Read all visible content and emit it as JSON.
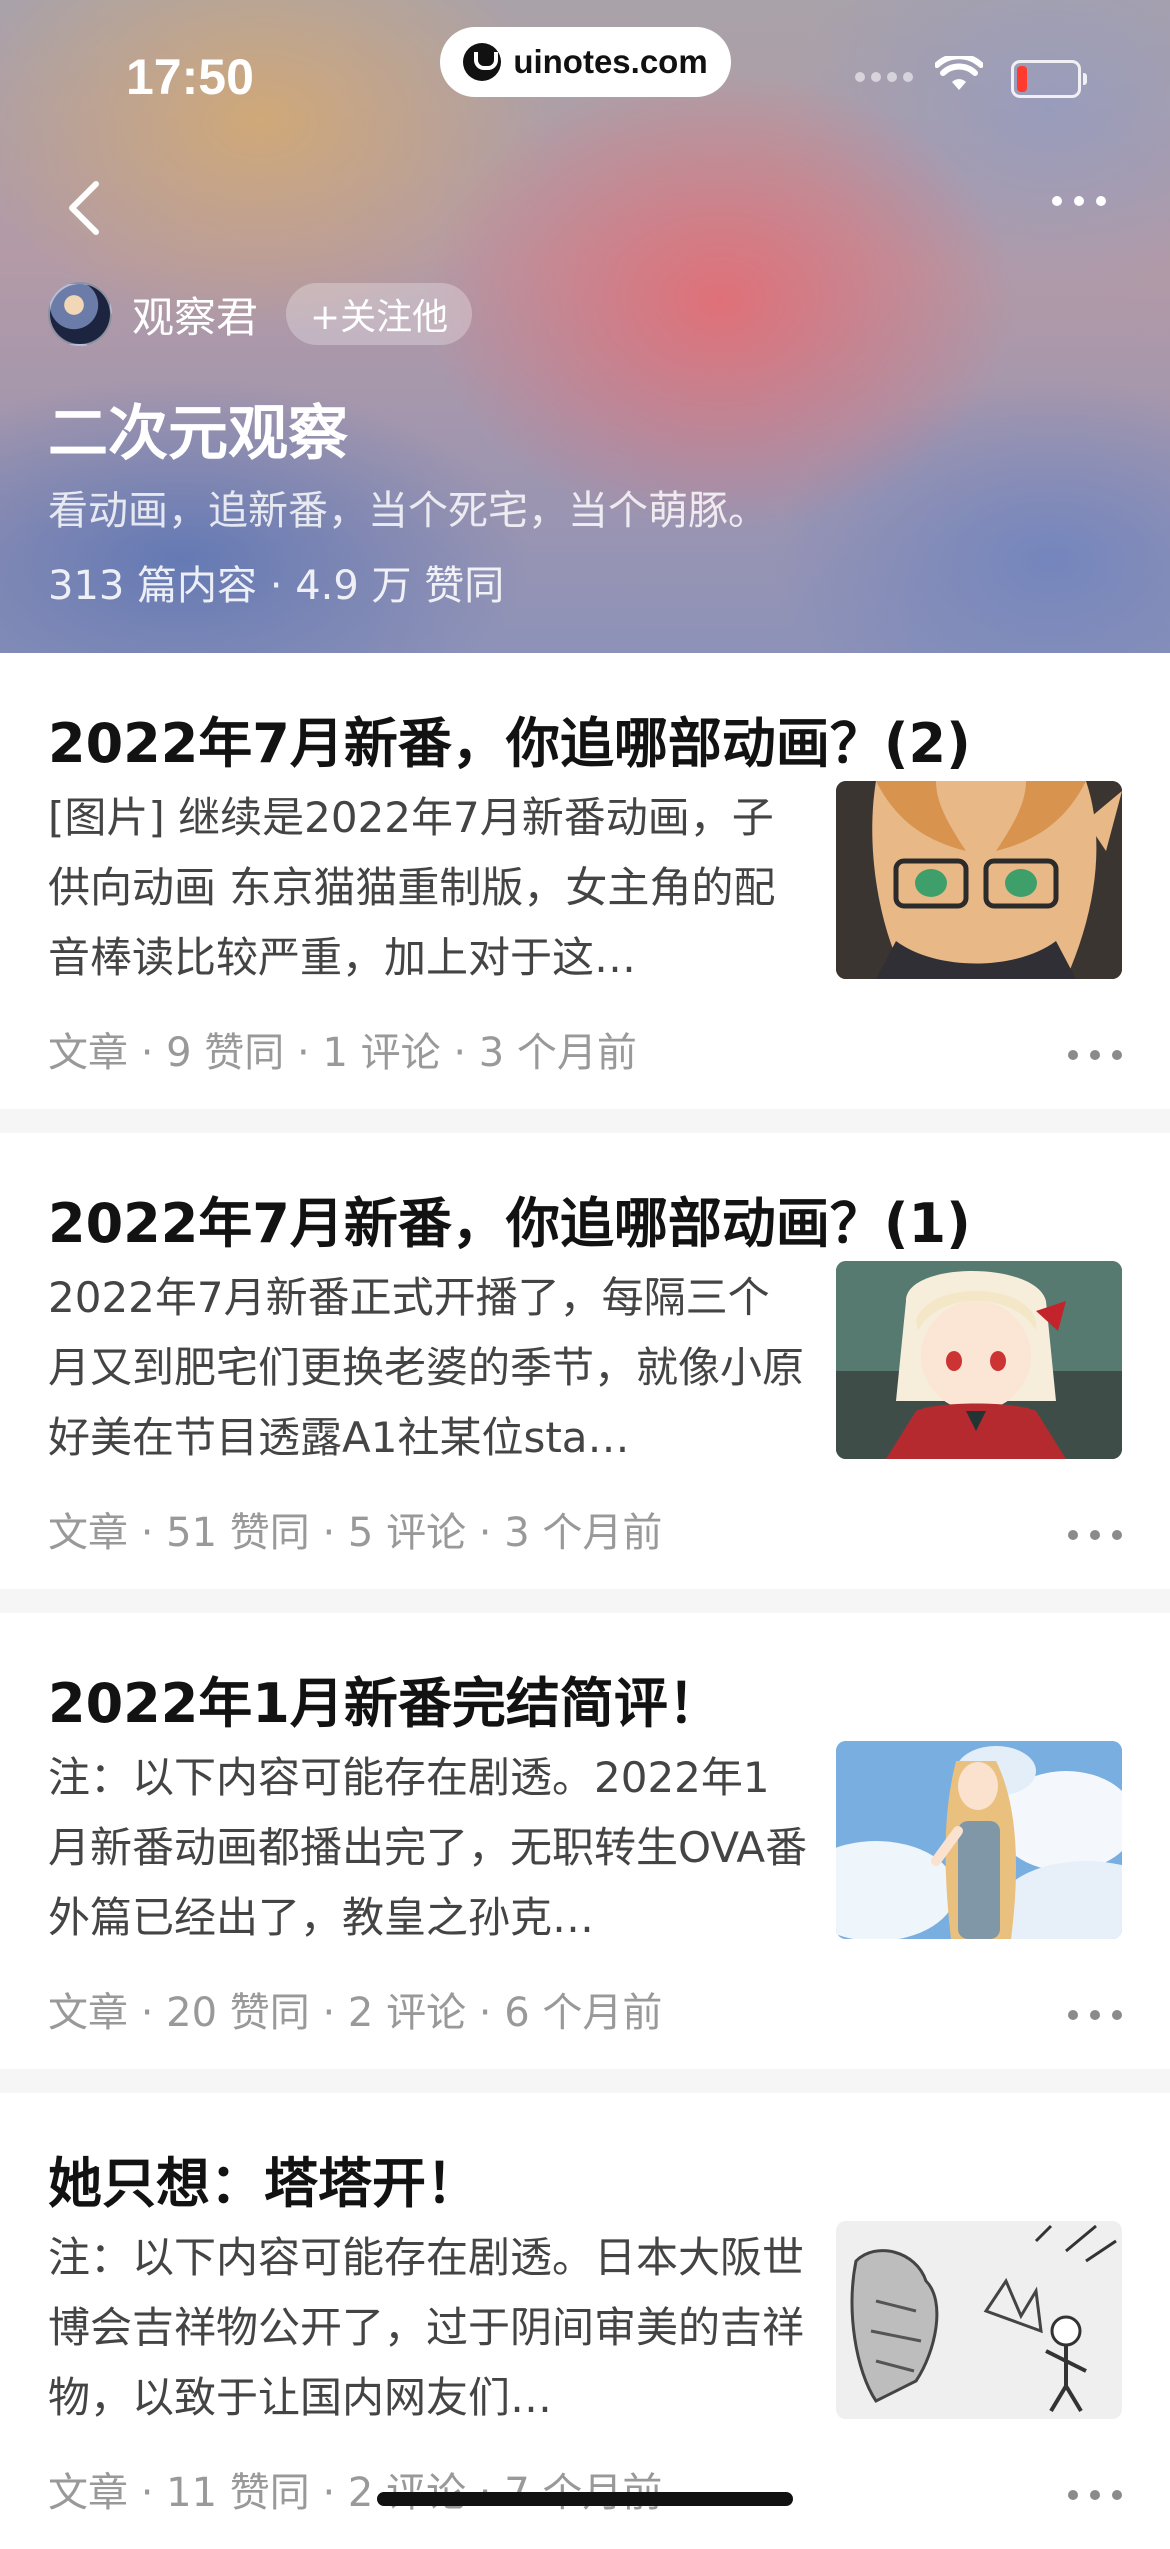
{
  "status_bar": {
    "time": "17:50",
    "url": "uinotes.com"
  },
  "header": {
    "author_name": "观察君",
    "follow_label": "+关注他",
    "column_title": "二次元观察",
    "column_desc": "看动画，追新番，当个死宅，当个萌豚。",
    "stats": "313 篇内容 · 4.9 万 赞同"
  },
  "articles": [
    {
      "title": "2022年7月新番，你追哪部动画？(2)",
      "excerpt": "[图片] 继续是2022年7月新番动画，子供向动画 东京猫猫重制版，女主角的配音棒读比较严重，加上对于这…",
      "meta": "文章 · 9 赞同 · 1 评论 · 3 个月前"
    },
    {
      "title": "2022年7月新番，你追哪部动画？(1)",
      "excerpt": "2022年7月新番正式开播了，每隔三个月又到肥宅们更换老婆的季节，就像小原好美在节目透露A1社某位sta…",
      "meta": "文章 · 51 赞同 · 5 评论 · 3 个月前"
    },
    {
      "title": "2022年1月新番完结简评！",
      "excerpt": "注：以下内容可能存在剧透。2022年1月新番动画都播出完了，无职转生OVA番外篇已经出了，教皇之孙克…",
      "meta": "文章 · 20 赞同 · 2 评论 · 6 个月前"
    },
    {
      "title": "她只想：塔塔开！",
      "excerpt": "注：以下内容可能存在剧透。日本大阪世博会吉祥物公开了，过于阴间审美的吉祥物，以致于让国内网友们…",
      "meta": "文章 · 11 赞同 · 2 评论 · 7 个月前"
    }
  ]
}
